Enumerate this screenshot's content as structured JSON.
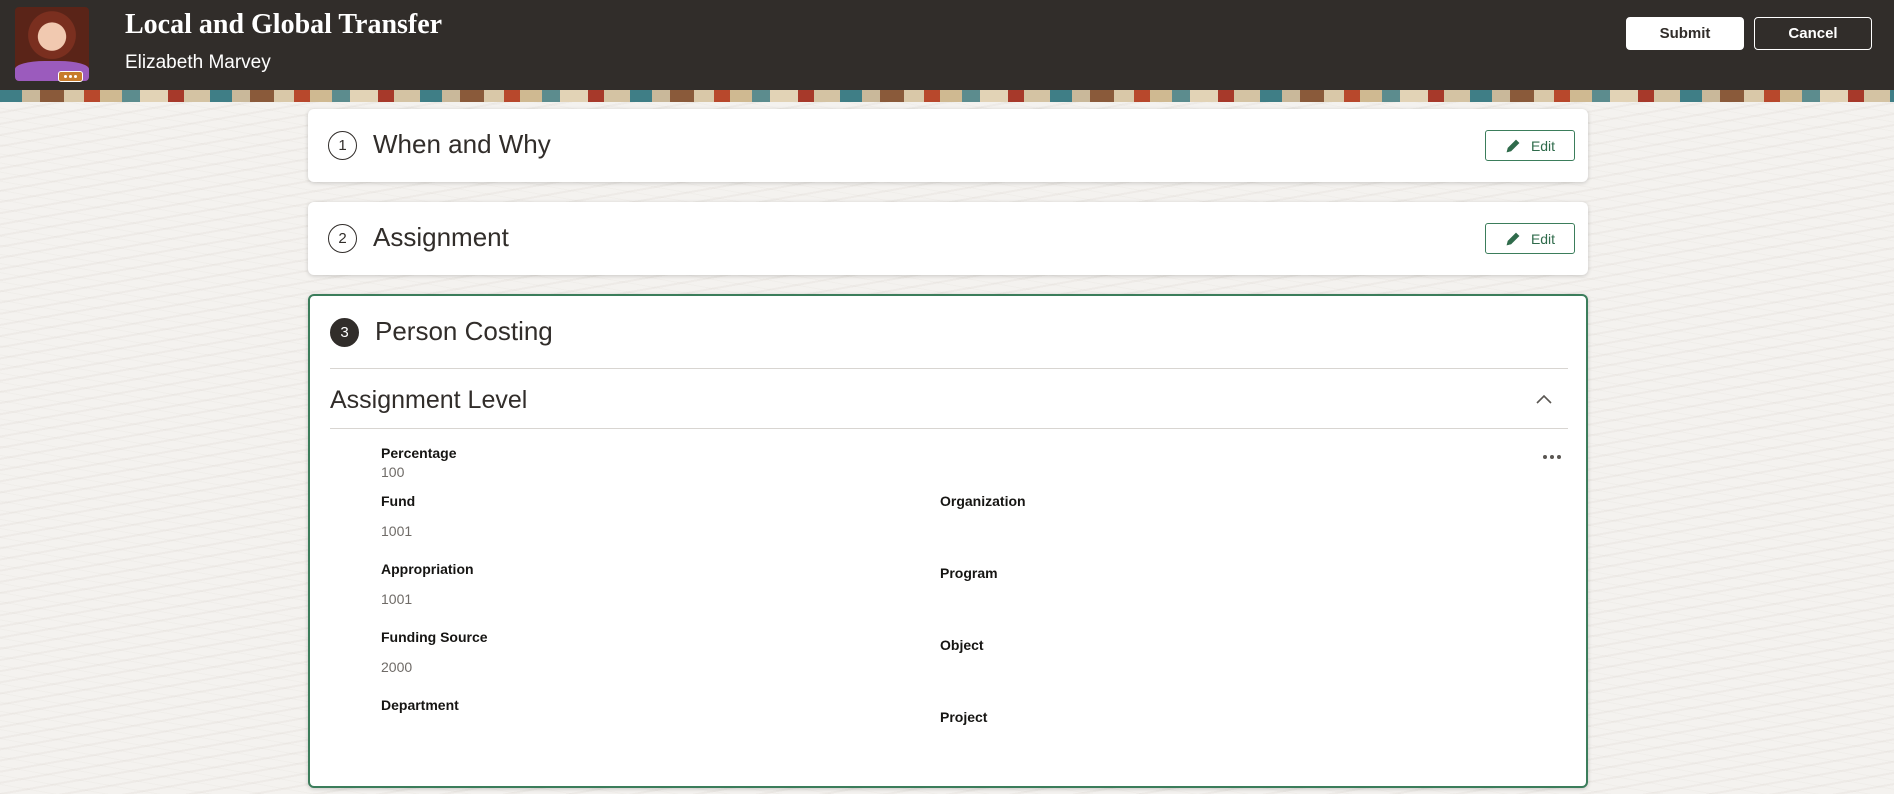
{
  "header": {
    "title": "Local and Global Transfer",
    "person_name": "Elizabeth Marvey",
    "submit_label": "Submit",
    "cancel_label": "Cancel"
  },
  "steps": [
    {
      "number": "1",
      "title": "When and Why",
      "edit_label": "Edit"
    },
    {
      "number": "2",
      "title": "Assignment",
      "edit_label": "Edit"
    },
    {
      "number": "3",
      "title": "Person Costing"
    }
  ],
  "person_costing": {
    "section_title": "Assignment Level",
    "fields": {
      "percentage": {
        "label": "Percentage",
        "value": "100"
      },
      "fund": {
        "label": "Fund",
        "value": "1001"
      },
      "appropriation": {
        "label": "Appropriation",
        "value": "1001"
      },
      "funding_source": {
        "label": "Funding Source",
        "value": "2000"
      },
      "department": {
        "label": "Department",
        "value": ""
      },
      "organization": {
        "label": "Organization",
        "value": ""
      },
      "program": {
        "label": "Program",
        "value": ""
      },
      "object": {
        "label": "Object",
        "value": ""
      },
      "project": {
        "label": "Project",
        "value": ""
      }
    }
  },
  "colors": {
    "header_bg": "#312d2a",
    "accent_green": "#3b7d5b",
    "page_bg": "#f4f2ef"
  }
}
